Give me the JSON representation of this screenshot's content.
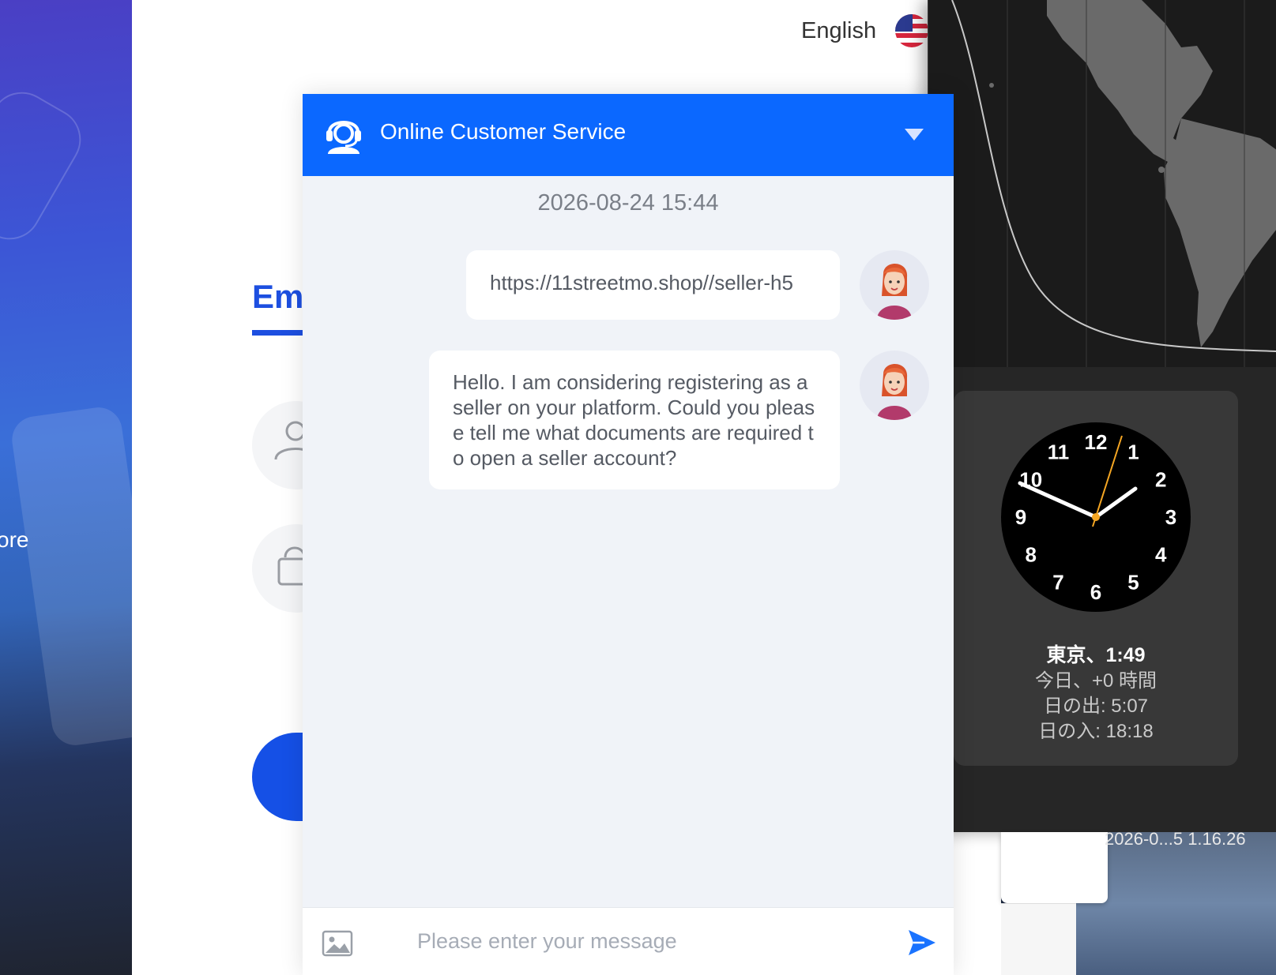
{
  "background": {
    "partial_text": "ore"
  },
  "login": {
    "language_label": "English",
    "partial_tab_label": "Em"
  },
  "chat": {
    "title": "Online Customer Service",
    "timestamp": "2026-08-24 15:44",
    "messages": [
      {
        "text": "https://11streetmo.shop//seller-h5"
      },
      {
        "text": "Hello. I am considering registering as a seller on your platform. Could you please tell me what documents are required to open a seller account?"
      }
    ],
    "input_placeholder": "Please enter your message",
    "accent_color": "#0b68ff"
  },
  "world_clock": {
    "city_time": "東京、1:49",
    "offset": "今日、+0 時間",
    "sunrise": "日の出: 5:07",
    "sunset": "日の入: 18:18",
    "hour_numbers": [
      "12",
      "1",
      "2",
      "3",
      "4",
      "5",
      "6",
      "7",
      "8",
      "9",
      "10",
      "11"
    ]
  },
  "stack": {
    "label": "2026-0...5 1.16.26"
  }
}
